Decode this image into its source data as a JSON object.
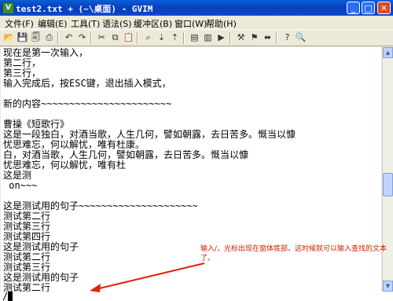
{
  "titlebar": {
    "title": "test2.txt + (~\\桌面) - GVIM",
    "app_icon_glyph": "V"
  },
  "window_controls": {
    "minimize": "_",
    "maximize": "□",
    "close": "✕"
  },
  "menu": [
    "文件(F)",
    "编辑(E)",
    "工具(T)",
    "语法(S)",
    "缓冲区(B)",
    "窗口(W)",
    "帮助(H)"
  ],
  "toolbar_icons": [
    "open-icon",
    "save-icon",
    "save-all-icon",
    "print-icon",
    "undo-icon",
    "redo-icon",
    "cut-icon",
    "copy-icon",
    "paste-icon",
    "find-replace-icon",
    "find-next-icon",
    "find-prev-icon",
    "load-session-icon",
    "save-session-icon",
    "run-script-icon",
    "make-icon",
    "tags-icon",
    "jump-tag-icon",
    "shell-icon",
    "help-icon",
    "find-help-icon"
  ],
  "editor": {
    "lines": [
      "现在是第一次输入，",
      "第二行，",
      "第三行，",
      "输入完成后，按ESC键，退出插入模式，",
      "",
      "新的内容~~~~~~~~~~~~~~~~~~~~~~~",
      "",
      "曹操《短歌行》",
      "这是一段独白，对酒当歌，人生几何，譬如朝露，去日苦多。慨当以慷",
      "忧思难忘，何以解忧，唯有杜康。",
      "白，对酒当歌，人生几何，譬如朝露，去日苦多。慨当以慷",
      "忧思难忘，何以解忧，唯有杜",
      "这是测",
      " on~~~",
      "",
      "这是测试用的句子~~~~~~~~~~~~~~~~~~~~~",
      "测试第二行",
      "测试第三行",
      "测试第四行",
      "这是测试用的句子",
      "测试第二行",
      "测试第三行",
      "这是测试用的句子",
      "测试第二行"
    ],
    "command_line": "/"
  },
  "annotation": {
    "text": "输入/，光标出现在窗体底部。这时候就可以输入查找的文本了。"
  },
  "colors": {
    "title_blue": "#0a40c4",
    "annotation_red": "#cc2200",
    "arrow_red": "#dd2211"
  }
}
